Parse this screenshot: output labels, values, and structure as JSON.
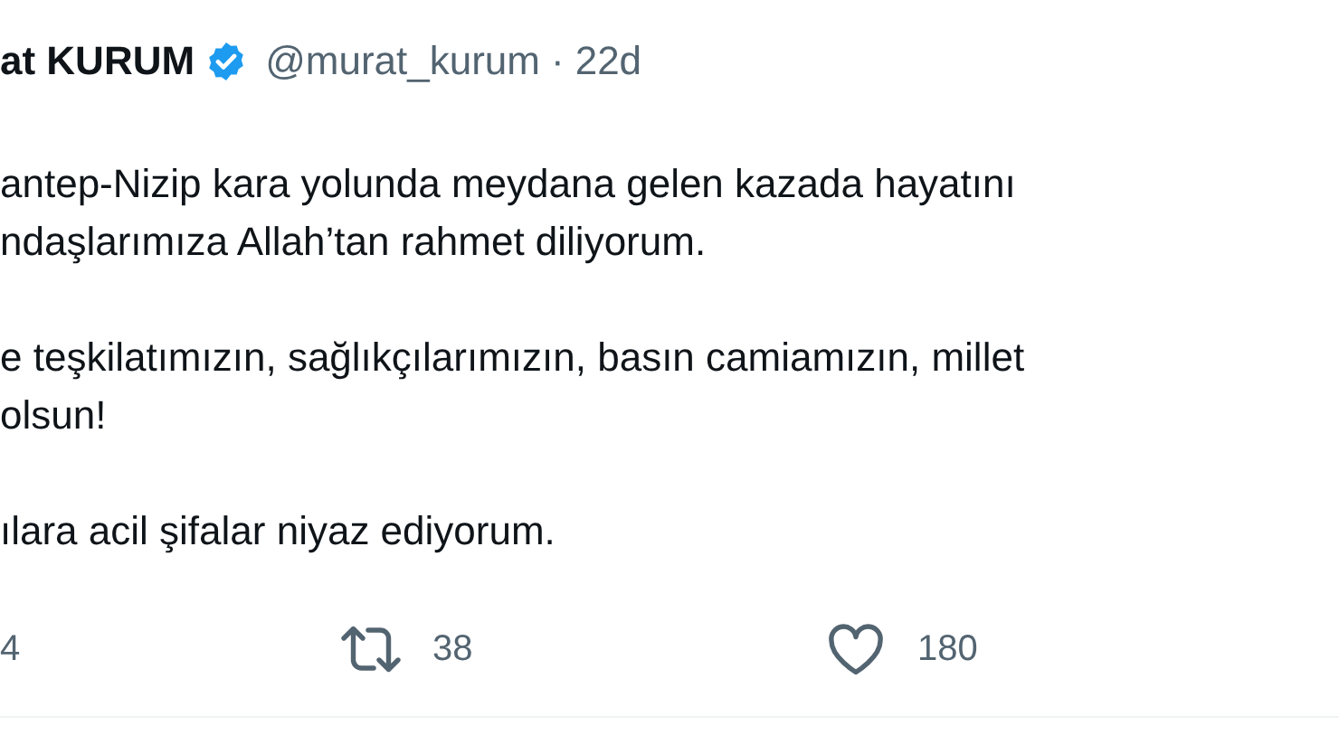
{
  "tweet": {
    "author_name": "at KURUM",
    "verified": true,
    "handle": "@murat_kurum",
    "separator": "·",
    "time": "22d",
    "paragraphs": [
      [
        "antep-Nizip kara yolunda meydana gelen kazada hayatını",
        "ndaşlarımıza Allah’tan rahmet diliyorum."
      ],
      [
        "e teşkilatımızın, sağlıkçılarımızın, basın camiamızın, millet",
        "olsun!"
      ],
      [
        "ılara acil şifalar niyaz ediyorum."
      ]
    ],
    "actions": [
      {
        "kind": "reply",
        "count": "4"
      },
      {
        "kind": "retweet",
        "count": "38"
      },
      {
        "kind": "like",
        "count": "180"
      }
    ]
  }
}
